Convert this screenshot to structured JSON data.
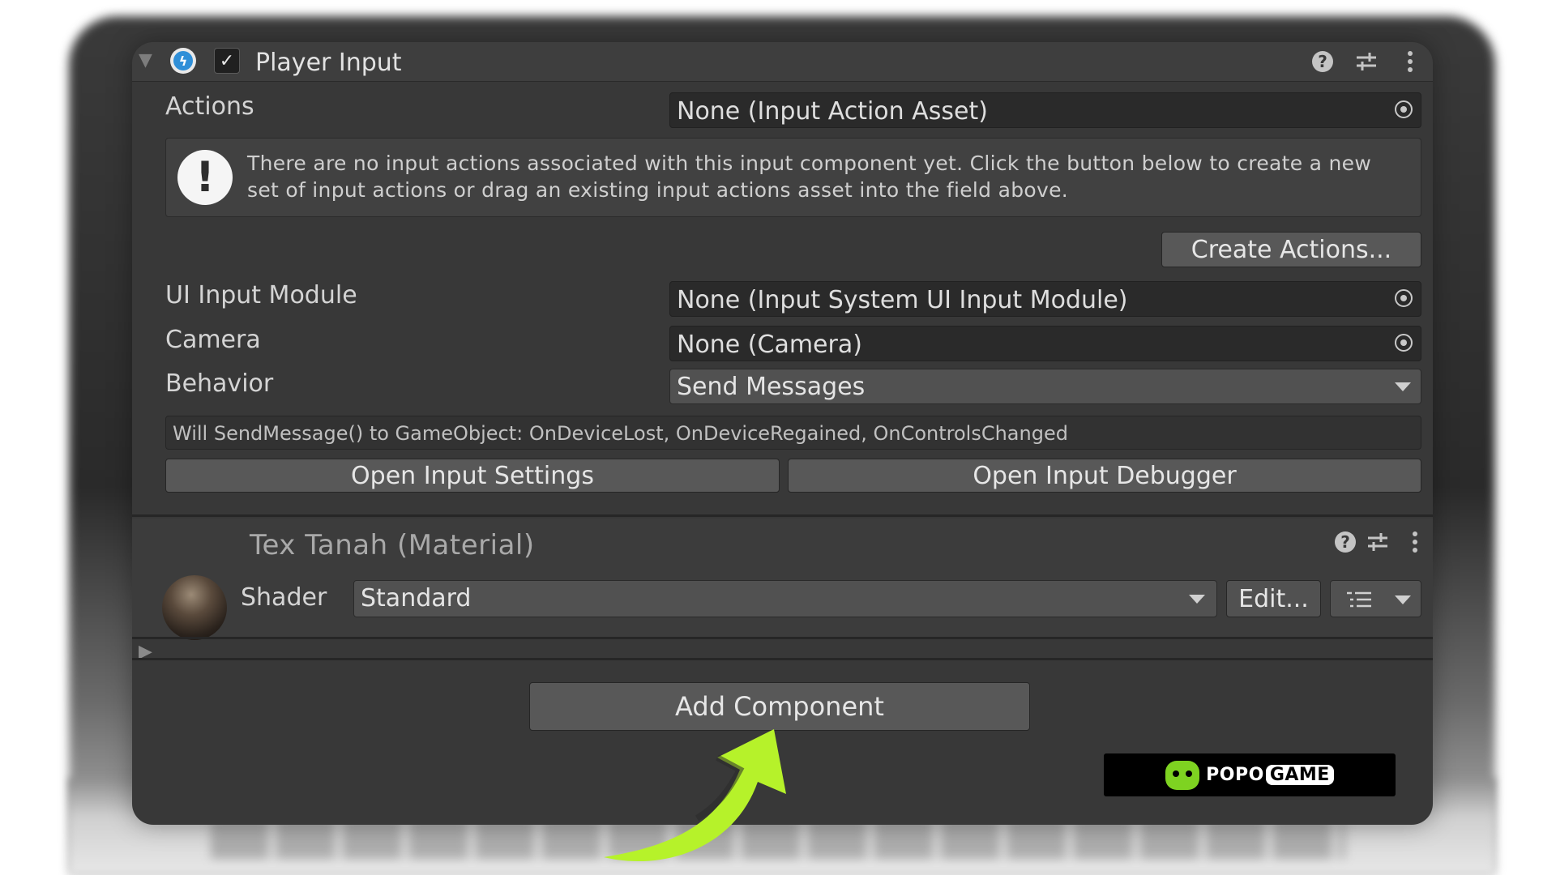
{
  "component": {
    "title": "Player Input",
    "enabled": true,
    "actions_label": "Actions",
    "actions_value": "None (Input Action Asset)",
    "help_text": "There are no input actions associated with this input component yet. Click the button below to create a new set of input actions or drag an existing input actions asset into the field above.",
    "create_actions_label": "Create Actions...",
    "ui_module_label": "UI Input Module",
    "ui_module_value": "None (Input System UI Input Module)",
    "camera_label": "Camera",
    "camera_value": "None (Camera)",
    "behavior_label": "Behavior",
    "behavior_value": "Send Messages",
    "info_line": "Will SendMessage() to GameObject: OnDeviceLost, OnDeviceRegained, OnControlsChanged",
    "open_settings_label": "Open Input Settings",
    "open_debugger_label": "Open Input Debugger"
  },
  "material": {
    "title": "Tex Tanah (Material)",
    "shader_label": "Shader",
    "shader_value": "Standard",
    "edit_label": "Edit..."
  },
  "add_component_label": "Add Component",
  "logo": {
    "text_popo": "POPO",
    "text_game": "GAME",
    "accent": "#7ed321"
  },
  "colors": {
    "arrow": "#b6f22a",
    "panel": "#383838"
  }
}
